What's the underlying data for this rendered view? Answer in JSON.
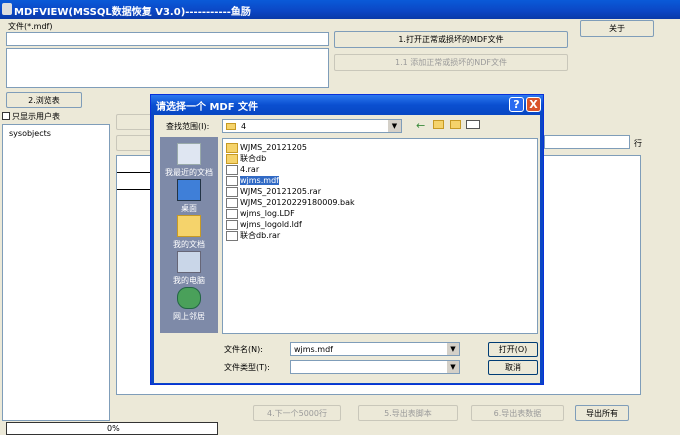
{
  "app": {
    "title": "MDFVIEW(MSSQL数据恢复 V3.0)-----------鱼肠"
  },
  "main": {
    "file_label": "文件(*.mdf)",
    "open_btn": "1.打开正常或损坏的MDF文件",
    "add_ndf_btn": "1.1 添加正常或损坏的NDF文件",
    "about_btn": "关于",
    "browse_btn": "2.浏览表",
    "only_user_tables": "只显示用户表",
    "tree_item": "sysobjects",
    "row_label": "行",
    "next_btn": "4.下一个5000行",
    "export_script_btn": "5.导出表脚本",
    "export_data_btn": "6.导出表数据",
    "export_all_btn": "导出所有",
    "progress": "0%"
  },
  "dialog": {
    "title": "请选择一个 MDF 文件",
    "lookin_label": "查找范围(I):",
    "lookin_value": "4",
    "places": [
      {
        "label": "我最近的文档",
        "icon": "recent-docs-icon"
      },
      {
        "label": "桌面",
        "icon": "desktop-icon"
      },
      {
        "label": "我的文档",
        "icon": "my-documents-icon"
      },
      {
        "label": "我的电脑",
        "icon": "my-computer-icon"
      },
      {
        "label": "网上邻居",
        "icon": "network-icon"
      }
    ],
    "files": [
      {
        "name": "WJMS_20121205",
        "type": "folder"
      },
      {
        "name": "联合db",
        "type": "folder"
      },
      {
        "name": "4.rar",
        "type": "file"
      },
      {
        "name": "wjms.mdf",
        "type": "file",
        "selected": true
      },
      {
        "name": "WJMS_20121205.rar",
        "type": "file"
      },
      {
        "name": "WJMS_20120229180009.bak",
        "type": "file"
      },
      {
        "name": "wjms_log.LDF",
        "type": "file"
      },
      {
        "name": "wjms_logold.ldf",
        "type": "file"
      },
      {
        "name": "联合db.rar",
        "type": "file"
      }
    ],
    "filename_label": "文件名(N):",
    "filename_value": "wjms.mdf",
    "filetype_label": "文件类型(T):",
    "filetype_value": "",
    "open_btn": "打开(O)",
    "cancel_btn": "取消",
    "help_btn": "?",
    "close_btn": "X"
  }
}
